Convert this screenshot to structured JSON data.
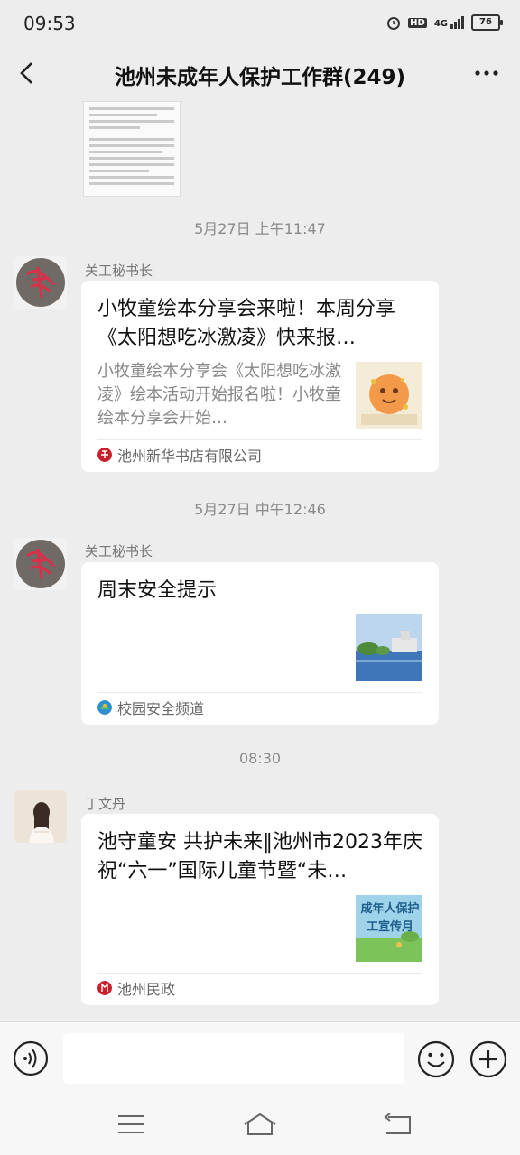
{
  "status": {
    "time": "09:53",
    "network": "4G",
    "hd": "HD",
    "battery": "76"
  },
  "header": {
    "title": "池州未成年人保护工作群(249)"
  },
  "messages": [
    {
      "timestamp": "5月27日 上午11:47",
      "sender": "关工秘书长",
      "card": {
        "title": "小牧童绘本分享会来啦！本周分享《太阳想吃冰激凌》快来报…",
        "desc": "小牧童绘本分享会《太阳想吃冰激凌》绘本活动开始报名啦！小牧童绘本分享会开始…",
        "source": "池州新华书店有限公司"
      }
    },
    {
      "timestamp": "5月27日 中午12:46",
      "sender": "关工秘书长",
      "card": {
        "title": "周末安全提示",
        "source": "校园安全频道"
      }
    },
    {
      "timestamp": "08:30",
      "sender": "丁文丹",
      "card": {
        "title": "池守童安 共护未来‖池州市2023年庆祝“六一”国际儿童节暨“未…",
        "image_text": "成年人保护工宣传月",
        "source": "池州民政"
      }
    }
  ],
  "input": {
    "placeholder": ""
  },
  "colors": {
    "background": "#ededed",
    "card": "#ffffff",
    "timestamp": "#8a8a8a"
  }
}
